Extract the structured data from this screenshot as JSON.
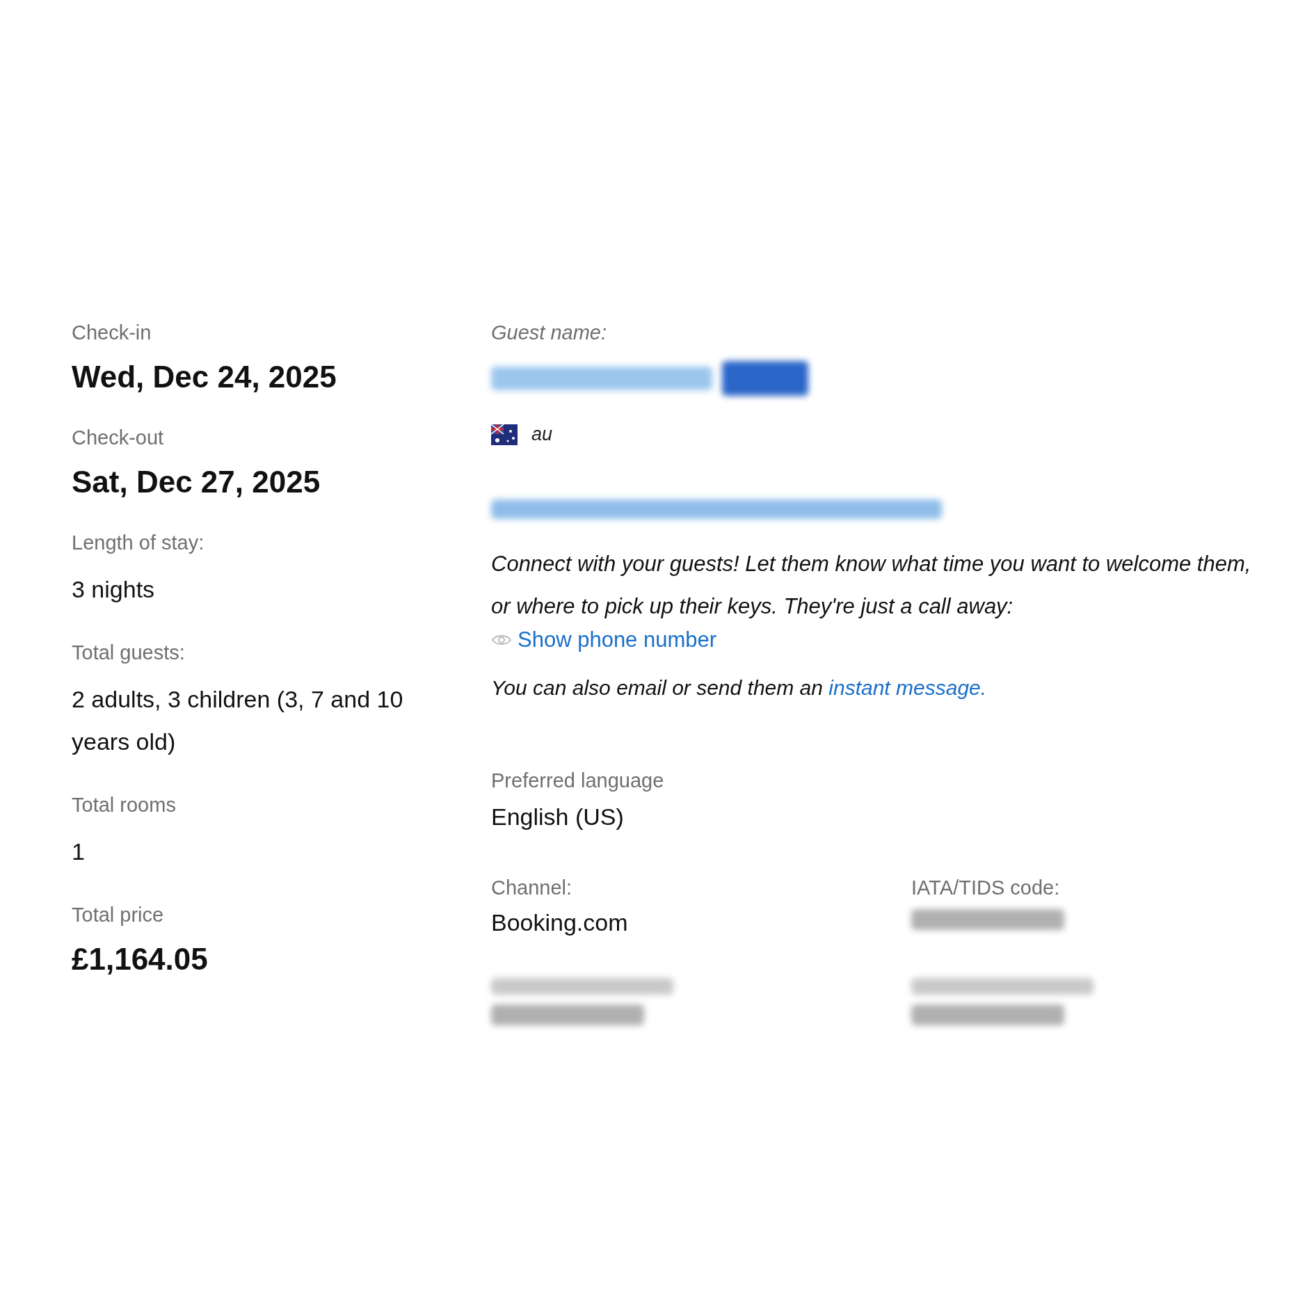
{
  "stay": [
    {
      "label": "Check-in",
      "value": "Wed, Dec 24, 2025",
      "kind": "big"
    },
    {
      "label": "Check-out",
      "value": "Sat, Dec 27, 2025",
      "kind": "big"
    },
    {
      "label": "Length of stay:",
      "value": "3 nights",
      "kind": "plain"
    },
    {
      "label": "Total guests:",
      "value": "2 adults, 3 children (3, 7 and 10 years old)",
      "kind": "plain"
    },
    {
      "label": "Total rooms",
      "value": "1",
      "kind": "plain"
    },
    {
      "label": "Total price",
      "value": "£1,164.05",
      "kind": "big"
    }
  ],
  "guest": {
    "label": "Guest name:",
    "name_blurred": true,
    "badge_blurred": true,
    "country": "au",
    "email_blurred": true,
    "message": "Connect with your guests! Let them know what time you want to welcome them, or where to pick up their keys. They're just a call away:",
    "phone_link": "Show phone number",
    "also_text": "You can also email or send them an ",
    "also_link": "instant message."
  },
  "language": {
    "label": "Preferred language",
    "value": "English (US)"
  },
  "details": [
    {
      "label": "Channel:",
      "value": "Booking.com"
    },
    {
      "label": "IATA/TIDS code:",
      "value_blurred": true
    },
    {
      "label_blurred": true,
      "value_blurred": true
    },
    {
      "label_blurred": true,
      "value_blurred": true
    }
  ]
}
